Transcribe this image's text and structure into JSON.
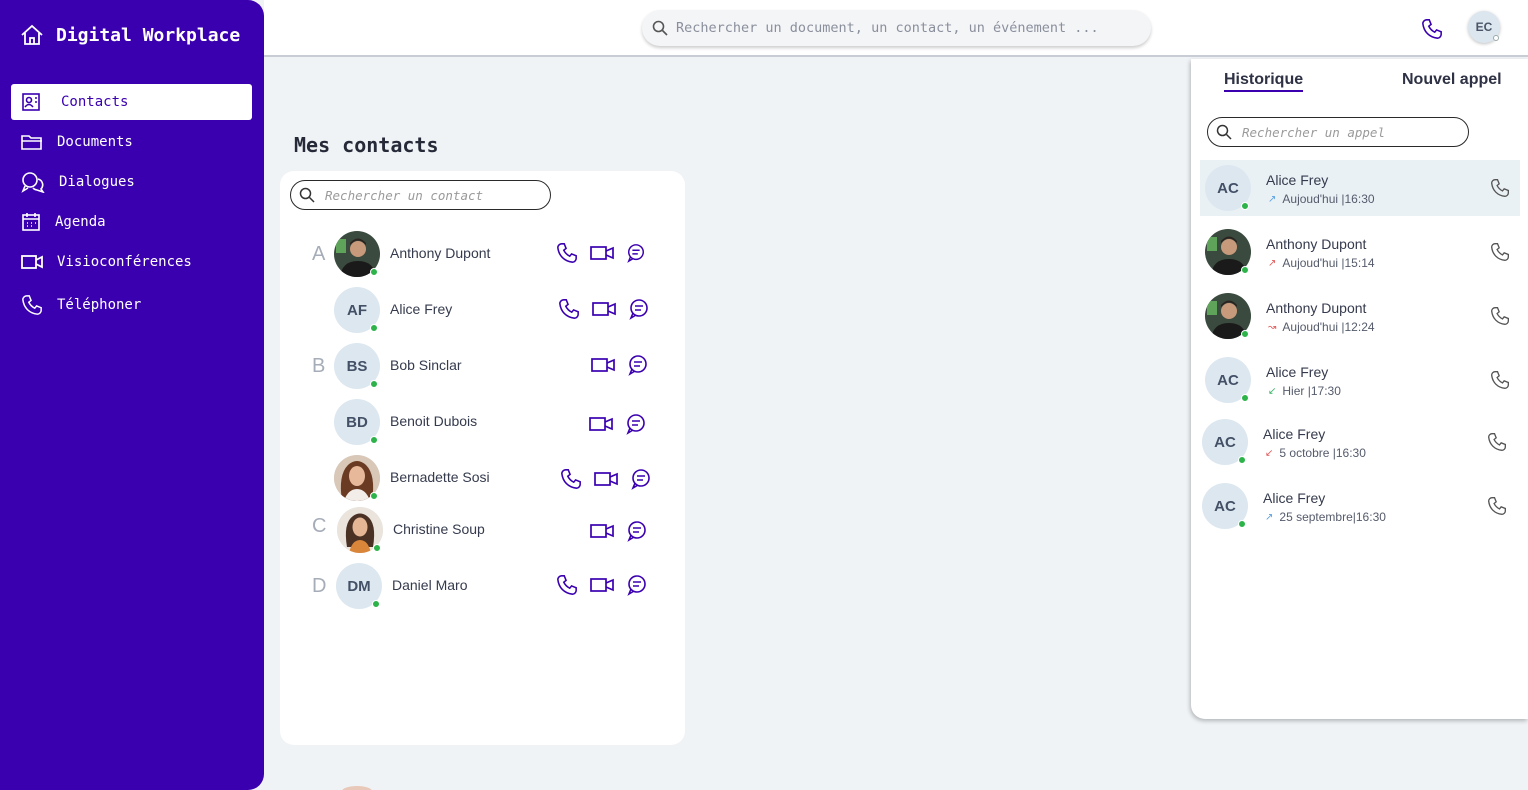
{
  "app": {
    "title": "Digital Workplace"
  },
  "nav": [
    {
      "label": "Contacts",
      "icon": "contact-book-icon",
      "active": true
    },
    {
      "label": "Documents",
      "icon": "folder-icon",
      "active": false
    },
    {
      "label": "Dialogues",
      "icon": "chat-bubbles-icon",
      "active": false
    },
    {
      "label": "Agenda",
      "icon": "calendar-icon",
      "active": false
    },
    {
      "label": "Visioconférences",
      "icon": "video-camera-icon",
      "active": false
    },
    {
      "label": "Téléphoner",
      "icon": "phone-icon",
      "active": false
    }
  ],
  "topbar": {
    "search_placeholder": "Rechercher un document, un contact, un événement ...",
    "user_initials": "EC"
  },
  "contacts": {
    "title": "Mes contacts",
    "search_placeholder": "Rechercher un contact",
    "letters": [
      "A",
      "B",
      "C",
      "D"
    ],
    "items": [
      {
        "name": "Anthony Dupont",
        "initials": "",
        "photo": "man",
        "actions": [
          "phone",
          "video",
          "chat"
        ]
      },
      {
        "name": "Alice Frey",
        "initials": "AF",
        "photo": "",
        "actions": [
          "phone",
          "video",
          "chat"
        ]
      },
      {
        "name": "Bob Sinclar",
        "initials": "BS",
        "photo": "",
        "actions": [
          "video",
          "chat"
        ]
      },
      {
        "name": "Benoit Dubois",
        "initials": "BD",
        "photo": "",
        "actions": [
          "video",
          "chat"
        ]
      },
      {
        "name": "Bernadette Sosi",
        "initials": "",
        "photo": "woman1",
        "actions": [
          "phone",
          "video",
          "chat"
        ]
      },
      {
        "name": "Christine Soup",
        "initials": "",
        "photo": "woman2",
        "actions": [
          "video",
          "chat"
        ]
      },
      {
        "name": "Daniel Maro",
        "initials": "DM",
        "photo": "",
        "actions": [
          "phone",
          "video",
          "chat"
        ]
      }
    ]
  },
  "history": {
    "tab_history": "Historique",
    "tab_new_call": "Nouvel appel",
    "search_placeholder": "Rechercher un appel",
    "items": [
      {
        "name": "Alice Frey",
        "initials": "AC",
        "photo": "",
        "direction": "outgoing",
        "when": "Aujoud'hui |16:30"
      },
      {
        "name": "Anthony Dupont",
        "initials": "",
        "photo": "man",
        "direction": "outgoing-missed",
        "when": "Aujoud'hui |15:14"
      },
      {
        "name": "Anthony Dupont",
        "initials": "",
        "photo": "man",
        "direction": "missed",
        "when": "Aujoud'hui |12:24"
      },
      {
        "name": "Alice Frey",
        "initials": "AC",
        "photo": "",
        "direction": "incoming",
        "when": "Hier |17:30"
      },
      {
        "name": "Alice Frey",
        "initials": "AC",
        "photo": "",
        "direction": "incoming-missed",
        "when": "5 octobre |16:30"
      },
      {
        "name": "Alice Frey",
        "initials": "AC",
        "photo": "",
        "direction": "outgoing",
        "when": "25 septembre|16:30"
      }
    ]
  },
  "colors": {
    "brand": "#3a00b0",
    "online": "#2cb34a",
    "background": "#f0f3f6"
  }
}
